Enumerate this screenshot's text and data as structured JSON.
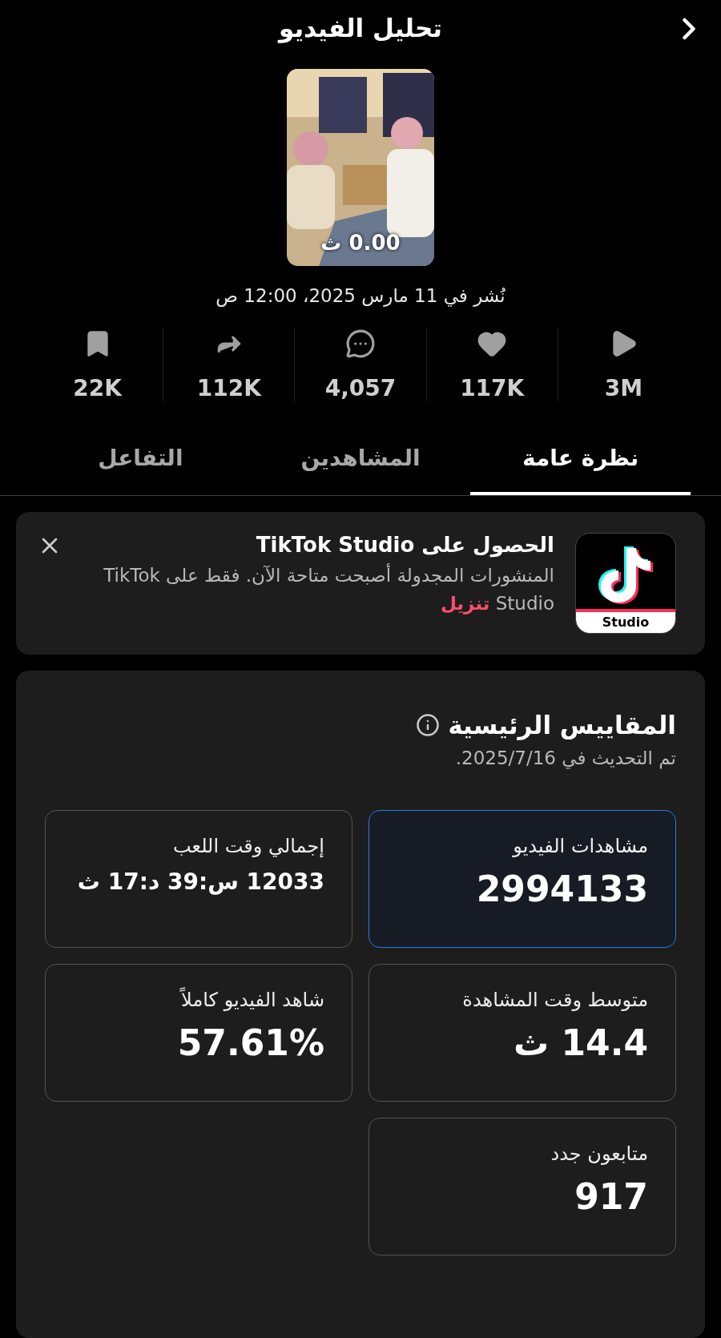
{
  "header": {
    "title": "تحليل الفيديو"
  },
  "video": {
    "kind": "picture",
    "duration": "0.00 ث",
    "published": "نُشر في 11 مارس 2025، 12:00 ص"
  },
  "stats": [
    {
      "kind": "views",
      "value": "3M"
    },
    {
      "kind": "likes",
      "value": "117K"
    },
    {
      "kind": "comments",
      "value": "4,057"
    },
    {
      "kind": "shares",
      "value": "112K"
    },
    {
      "kind": "saves",
      "value": "22K"
    }
  ],
  "tabs": [
    {
      "label": "نظرة عامة",
      "selected": true
    },
    {
      "label": "المشاهدين",
      "selected": false
    },
    {
      "label": "التفاعل",
      "selected": false
    }
  ],
  "banner": {
    "title": "الحصول على TikTok Studio",
    "text": "المنشورات المجدولة أصبحت متاحة الآن. فقط على TikTok Studio",
    "link": "تنزيل",
    "app_label": "Studio"
  },
  "metrics": {
    "title": "المقاييس الرئيسية",
    "updated": "تم التحديث في 2025/7/16.",
    "items": [
      {
        "label": "مشاهدات الفيديو",
        "value": "2994133",
        "selected": true
      },
      {
        "label": "إجمالي وقت اللعب",
        "value": "12033 س:39 د:17 ث",
        "selected": false
      },
      {
        "label": "متوسط وقت المشاهدة",
        "value": "14.4 ث",
        "selected": false
      },
      {
        "label": "شاهد الفيديو كاملاً",
        "value": "57.61%",
        "selected": false
      },
      {
        "label": "متابعون جدد",
        "value": "917",
        "selected": false
      }
    ]
  }
}
